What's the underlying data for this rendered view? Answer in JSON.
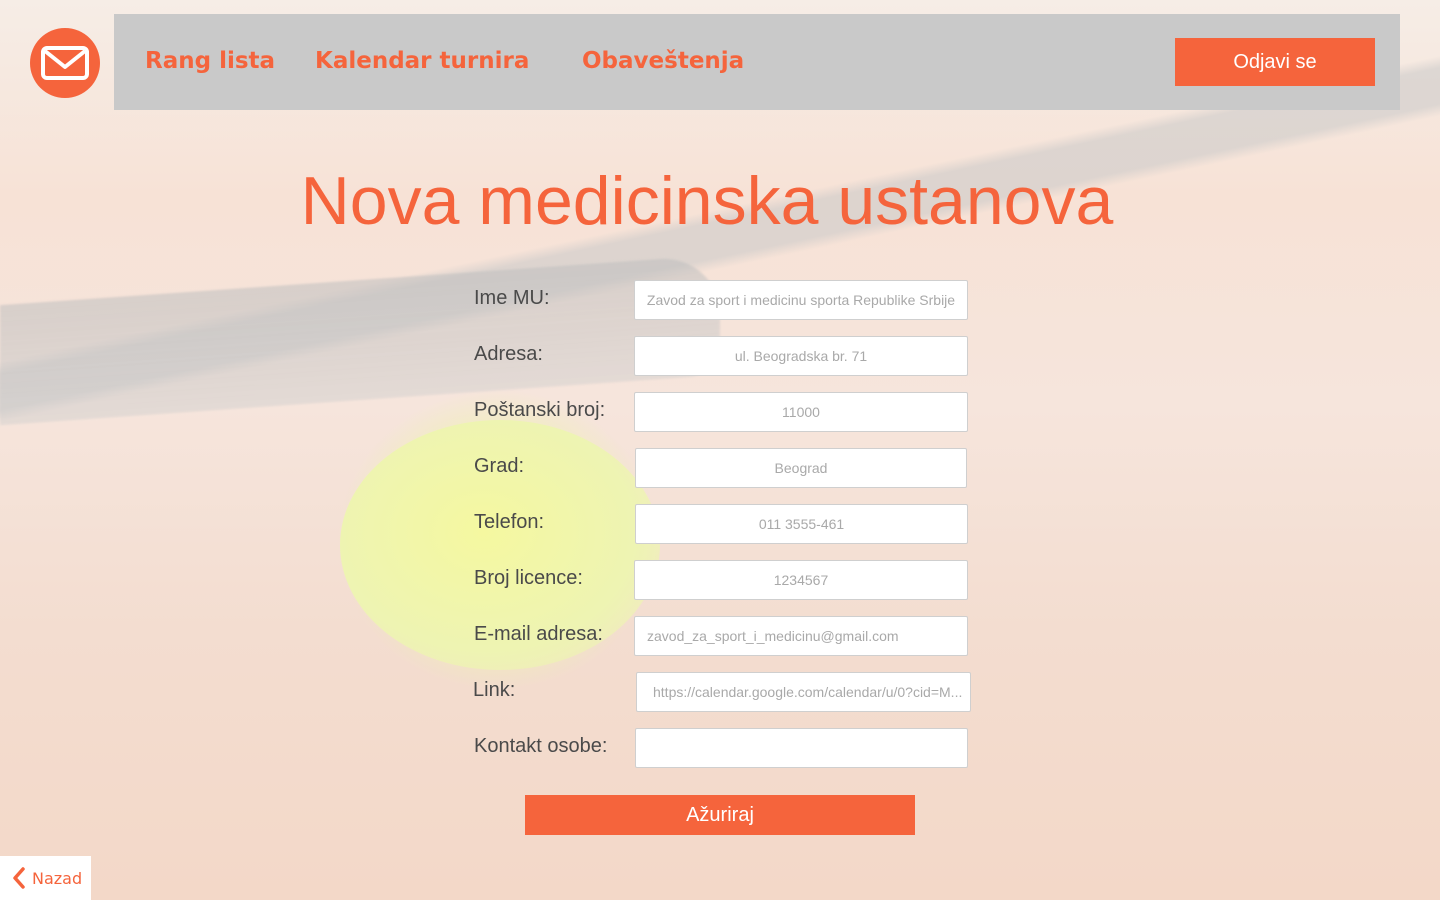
{
  "app": {
    "brand_color": "#f5643c",
    "logo_icon": "envelope-icon"
  },
  "nav": {
    "links": [
      {
        "label": "Rang lista"
      },
      {
        "label": "Kalendar turnira"
      },
      {
        "label": "Obaveštenja"
      }
    ],
    "logout_label": "Odjavi se"
  },
  "page": {
    "title": "Nova medicinska ustanova"
  },
  "form": {
    "fields": [
      {
        "label": "Ime MU:",
        "placeholder": "Zavod za sport i medicinu sporta Republike Srbije",
        "value": ""
      },
      {
        "label": "Adresa:",
        "placeholder": "ul. Beogradska br. 71",
        "value": ""
      },
      {
        "label": "Poštanski broj:",
        "placeholder": "11000",
        "value": ""
      },
      {
        "label": "Grad:",
        "placeholder": "Beograd",
        "value": ""
      },
      {
        "label": "Telefon:",
        "placeholder": "011 3555-461",
        "value": ""
      },
      {
        "label": "Broj licence:",
        "placeholder": "1234567",
        "value": ""
      },
      {
        "label": "E-mail adresa:",
        "placeholder": "zavod_za_sport_i_medicinu@gmail.com",
        "value": ""
      },
      {
        "label": "Link:",
        "placeholder": "https://calendar.google.com/calendar/u/0?cid=M...",
        "value": ""
      },
      {
        "label": "Kontakt osobe:",
        "placeholder": "",
        "value": ""
      }
    ],
    "submit_label": "Ažuriraj"
  },
  "back": {
    "label": "Nazad",
    "icon": "chevron-left-icon"
  }
}
